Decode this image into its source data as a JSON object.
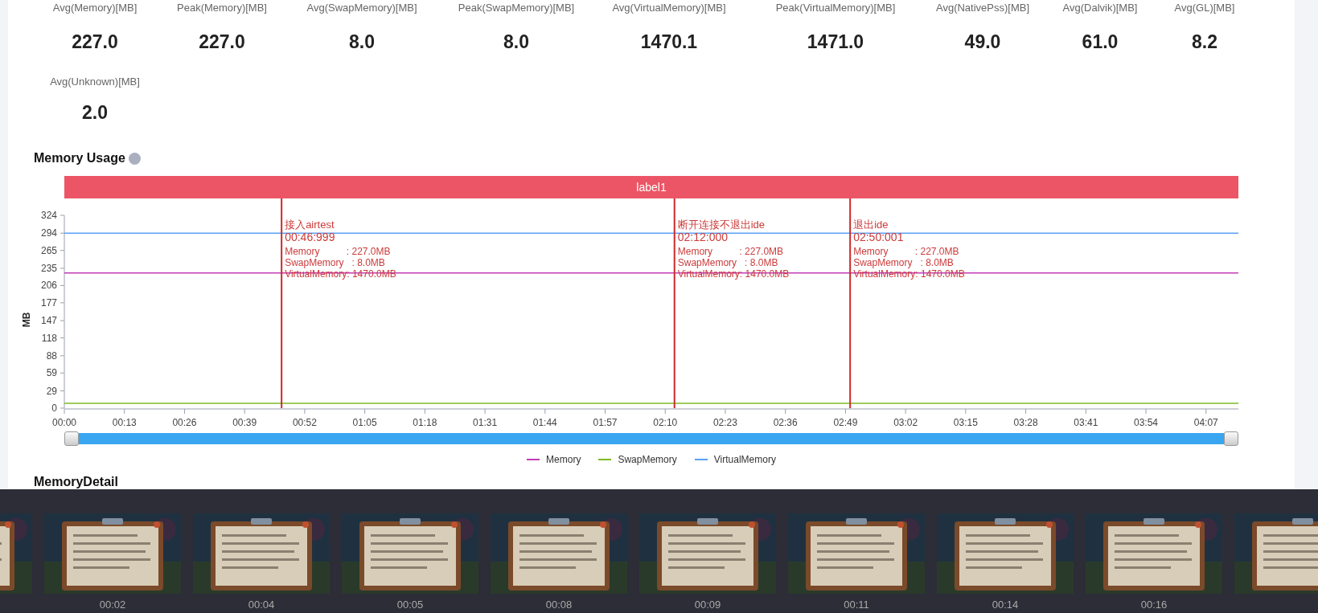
{
  "summary": {
    "row_1": [
      {
        "label": "Avg(Memory)[MB]",
        "value": "227.0"
      },
      {
        "label": "Peak(Memory)[MB]",
        "value": "227.0"
      },
      {
        "label": "Avg(SwapMemory)[MB]",
        "value": "8.0"
      },
      {
        "label": "Peak(SwapMemory)[MB]",
        "value": "8.0"
      },
      {
        "label": "Avg(VirtualMemory)[MB]",
        "value": "1470.1"
      },
      {
        "label": "Peak(VirtualMemory)[MB]",
        "value": "1471.0"
      },
      {
        "label": "Avg(NativePss)[MB]",
        "value": "49.0"
      },
      {
        "label": "Avg(Dalvik)[MB]",
        "value": "61.0"
      },
      {
        "label": "Avg(GL)[MB]",
        "value": "8.2"
      }
    ],
    "row_2": [
      {
        "label": "Avg(Unknown)[MB]",
        "value": "2.0"
      }
    ]
  },
  "memory_usage": {
    "title": "Memory Usage",
    "label_bar": "label1",
    "chart_data": {
      "type": "line",
      "ylabel": "MB",
      "xlim": [
        0,
        254
      ],
      "ylim": [
        0,
        324
      ],
      "x": [
        0,
        254
      ],
      "series": [
        {
          "name": "Memory",
          "color": "#c23cb5",
          "values": [
            227,
            227
          ]
        },
        {
          "name": "SwapMemory",
          "color": "#7cbb25",
          "values": [
            8,
            8
          ]
        },
        {
          "name": "VirtualMemory",
          "color": "#5aa0f5",
          "values": [
            294,
            294
          ]
        }
      ],
      "yticks": [
        0,
        29,
        59,
        88,
        118,
        147,
        177,
        206,
        235,
        265,
        294,
        324
      ],
      "xticks": [
        {
          "value": 0,
          "label": "00:00"
        },
        {
          "value": 13,
          "label": "00:13"
        },
        {
          "value": 26,
          "label": "00:26"
        },
        {
          "value": 39,
          "label": "00:39"
        },
        {
          "value": 52,
          "label": "00:52"
        },
        {
          "value": 65,
          "label": "01:05"
        },
        {
          "value": 78,
          "label": "01:18"
        },
        {
          "value": 91,
          "label": "01:31"
        },
        {
          "value": 104,
          "label": "01:44"
        },
        {
          "value": 117,
          "label": "01:57"
        },
        {
          "value": 130,
          "label": "02:10"
        },
        {
          "value": 143,
          "label": "02:23"
        },
        {
          "value": 156,
          "label": "02:36"
        },
        {
          "value": 169,
          "label": "02:49"
        },
        {
          "value": 182,
          "label": "03:02"
        },
        {
          "value": 195,
          "label": "03:15"
        },
        {
          "value": 208,
          "label": "03:28"
        },
        {
          "value": 221,
          "label": "03:41"
        },
        {
          "value": 234,
          "label": "03:54"
        },
        {
          "value": 247,
          "label": "04:07"
        }
      ],
      "ref_lines": [
        {
          "axis": "x",
          "value": 46.999,
          "label": "接入airtest"
        },
        {
          "axis": "x",
          "value": 132,
          "label": "断开连接不退出ide"
        },
        {
          "axis": "x",
          "value": 170.001,
          "label": "退出ide"
        }
      ]
    },
    "markers": [
      {
        "time": "00:46:999",
        "details": [
          "Memory          : 227.0MB",
          "SwapMemory   : 8.0MB",
          "VirtualMemory: 1470.0MB"
        ]
      },
      {
        "time": "02:12:000",
        "details": [
          "Memory          : 227.0MB",
          "SwapMemory   : 8.0MB",
          "VirtualMemory: 1470.0MB"
        ]
      },
      {
        "time": "02:50:001",
        "details": [
          "Memory          : 227.0MB",
          "SwapMemory   : 8.0MB",
          "VirtualMemory: 1470.0MB"
        ]
      }
    ],
    "zoom_slider": {
      "kind": "range"
    }
  },
  "memory_detail": {
    "title": "MemoryDetail"
  },
  "filmstrip": [
    {
      "kind": "picture"
    },
    {
      "kind": "picture",
      "time": "00:02"
    },
    {
      "kind": "picture",
      "time": "00:04"
    },
    {
      "kind": "picture",
      "time": "00:05"
    },
    {
      "kind": "picture",
      "time": "00:08"
    },
    {
      "kind": "picture",
      "time": "00:09"
    },
    {
      "kind": "picture",
      "time": "00:11"
    },
    {
      "kind": "picture",
      "time": "00:14"
    },
    {
      "kind": "picture",
      "time": "00:16"
    },
    {
      "kind": "picture"
    }
  ]
}
